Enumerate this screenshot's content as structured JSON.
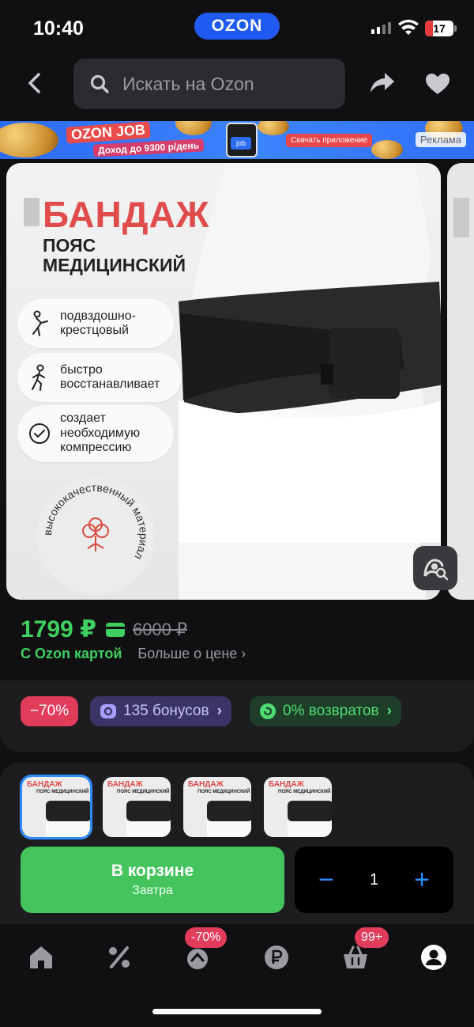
{
  "status": {
    "time": "10:40",
    "app_badge": "OZON",
    "battery": "17"
  },
  "header": {
    "search_placeholder": "Искать на Ozon"
  },
  "banner": {
    "brand": "OZON JOB",
    "income": "Доход до 9300 р/день",
    "phone_label": "job",
    "cta": "Скачать приложение",
    "ad_label": "Реклама"
  },
  "product_image": {
    "title": "БАНДАЖ",
    "subtitle_line1": "ПОЯС",
    "subtitle_line2": "МЕДИЦИНСКИЙ",
    "features": [
      {
        "icon": "person-bending-icon",
        "line1": "подвздошно-",
        "line2": "крестцовый",
        "line3": ""
      },
      {
        "icon": "person-walking-icon",
        "line1": "быстро",
        "line2": "восстанавливает",
        "line3": ""
      },
      {
        "icon": "check-circle-icon",
        "line1": "создает",
        "line2": "необходимую",
        "line3": "компрессию"
      }
    ],
    "quality_stamp": "высококачественный материал"
  },
  "price": {
    "current": "1799 ₽",
    "old": "6000 ₽",
    "ozon_card": "С Ozon картой",
    "more": "Больше о цене"
  },
  "chips": {
    "discount": "−70%",
    "bonus": "135 бонусов",
    "returns": "0% возвратов"
  },
  "thumbs": [
    {
      "title": "БАНДАЖ",
      "sub": "ПОЯС МЕДИЦИНСКИЙ"
    },
    {
      "title": "БАНДАЖ",
      "sub": "ПОЯС МЕДИЦИНСКИЙ"
    },
    {
      "title": "БАНДАЖ",
      "sub": "ПОЯС МЕДИЦИНСКИЙ"
    },
    {
      "title": "БАНДАЖ",
      "sub": "ПОЯС МЕДИЦИНСКИЙ"
    }
  ],
  "cart": {
    "label": "В корзине",
    "delivery": "Завтра",
    "quantity": "1",
    "minus": "−",
    "plus": "+"
  },
  "nav": {
    "fresh_badge": "-70%",
    "cart_badge": "99+"
  },
  "colors": {
    "accent_green": "#3ecf5f",
    "ozon_blue": "#1f5bf2",
    "discount_red": "#e23c5b",
    "link_blue": "#2f8cff"
  }
}
